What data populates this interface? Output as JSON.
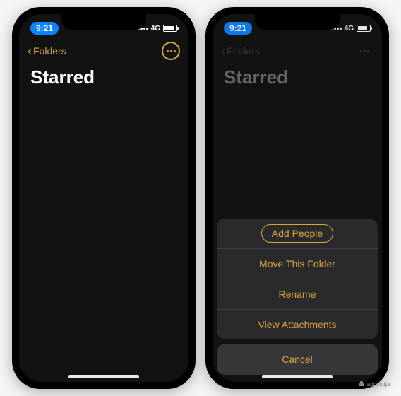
{
  "status": {
    "time": "9:21",
    "carrier_text": "4G"
  },
  "nav": {
    "back_label": "Folders",
    "title": "Starred"
  },
  "sheet": {
    "add_people": "Add People",
    "move": "Move This Folder",
    "rename": "Rename",
    "view_attachments": "View Attachments",
    "cancel": "Cancel"
  },
  "watermark": "appsntips"
}
